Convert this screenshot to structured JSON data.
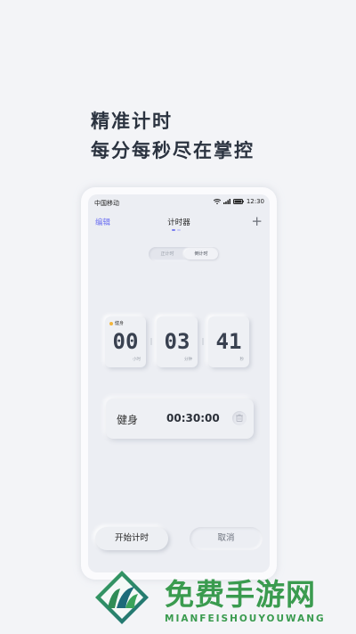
{
  "headline": {
    "line1": "精准计时",
    "line2": "每分每秒尽在掌控"
  },
  "status_bar": {
    "carrier": "中国移动",
    "time": "12:30"
  },
  "nav": {
    "edit": "编辑",
    "title": "计时器",
    "add": "+"
  },
  "segments": {
    "left": "正计时",
    "right": "倒计时",
    "selected": "倒计时"
  },
  "timer": {
    "tag": "健身",
    "tag_color": "#f2b53b",
    "hours": "00",
    "hours_unit": "小时",
    "minutes": "03",
    "minutes_unit": "分钟",
    "seconds": "41",
    "seconds_unit": "秒"
  },
  "task": {
    "name": "健身",
    "duration": "00:30:00",
    "icon": "trash-icon"
  },
  "buttons": {
    "start": "开始计时",
    "cancel": "取消"
  },
  "brand": {
    "cn": "免费手游网",
    "en": "MIANFEISHOUYOUWANG",
    "color": "#3a9b4f"
  },
  "accent": "#6b6ff2"
}
